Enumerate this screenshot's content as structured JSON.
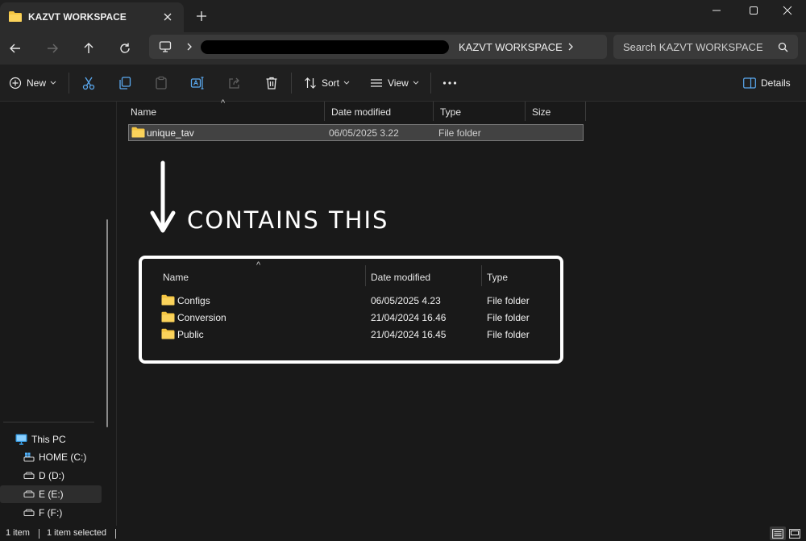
{
  "window": {
    "tab_title": "KAZVT WORKSPACE",
    "new_tab_icon": "plus-icon",
    "controls": [
      "minimize-icon",
      "maximize-icon",
      "close-icon"
    ]
  },
  "nav": {
    "address_current": "KAZVT WORKSPACE",
    "address_redacted": true,
    "search_placeholder": "Search KAZVT WORKSPACE"
  },
  "toolbar": {
    "new_label": "New",
    "sort_label": "Sort",
    "view_label": "View",
    "details_label": "Details"
  },
  "sidebar": {
    "items": [
      {
        "label": "This PC",
        "icon": "monitor-icon",
        "selected": false
      },
      {
        "label": "HOME (C:)",
        "icon": "windows-drive-icon",
        "selected": false
      },
      {
        "label": "D (D:)",
        "icon": "drive-icon",
        "selected": false
      },
      {
        "label": "E (E:)",
        "icon": "drive-icon",
        "selected": true
      },
      {
        "label": "F (F:)",
        "icon": "drive-icon",
        "selected": false
      }
    ]
  },
  "list": {
    "columns": [
      "Name",
      "Date modified",
      "Type",
      "Size"
    ],
    "sort_indicator": "^",
    "rows": [
      {
        "name": "unique_tav",
        "date": "06/05/2025 3.22",
        "type": "File folder",
        "size": "",
        "selected": true
      }
    ]
  },
  "annotation": {
    "text": "CONTAINS THIS"
  },
  "inset": {
    "columns": [
      "Name",
      "Date modified",
      "Type"
    ],
    "sort_indicator": "^",
    "rows": [
      {
        "name": "Configs",
        "date": "06/05/2025 4.23",
        "type": "File folder"
      },
      {
        "name": "Conversion",
        "date": "21/04/2024 16.46",
        "type": "File folder"
      },
      {
        "name": "Public",
        "date": "21/04/2024 16.45",
        "type": "File folder"
      }
    ]
  },
  "status": {
    "item_count": "1 item",
    "selected_count": "1 item selected"
  },
  "colors": {
    "folder": "#f4c542",
    "background": "#191919",
    "selection": "#424242"
  }
}
